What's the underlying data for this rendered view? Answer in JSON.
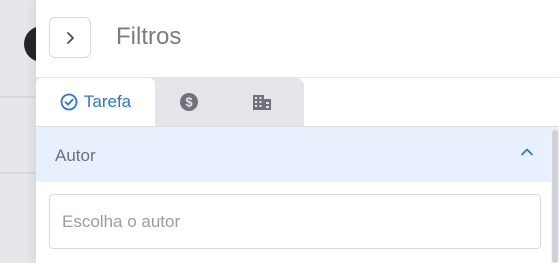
{
  "header": {
    "title": "Filtros",
    "toggle_icon": "chevron-right-icon"
  },
  "tabs": [
    {
      "label": "Tarefa",
      "icon": "check-circle-icon",
      "active": true
    },
    {
      "label": "",
      "icon": "dollar-circle-icon",
      "active": false
    },
    {
      "label": "",
      "icon": "building-icon",
      "active": false
    }
  ],
  "section": {
    "title": "Autor",
    "expanded": true,
    "collapse_icon": "chevron-up-icon"
  },
  "author_field": {
    "value": "",
    "placeholder": "Escolha o autor"
  },
  "colors": {
    "accent": "#2d72e0",
    "section_bg": "#e9f0fd",
    "tab_bar_bg": "#e4e5ea"
  }
}
